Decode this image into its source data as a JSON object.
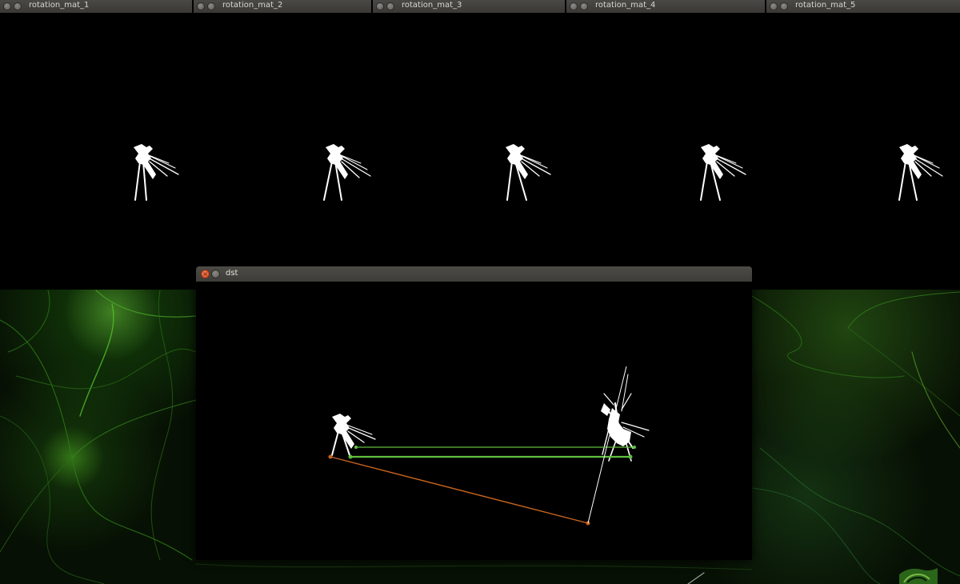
{
  "windows": [
    {
      "title": "rotation_mat_1"
    },
    {
      "title": "rotation_mat_2"
    },
    {
      "title": "rotation_mat_3"
    },
    {
      "title": "rotation_mat_4"
    },
    {
      "title": "rotation_mat_5"
    }
  ],
  "dst_window": {
    "title": "dst"
  },
  "colors": {
    "titlebar": "#3e3d39",
    "close_button": "#e0532b",
    "match_line_green": "#5fbf3f",
    "match_line_orange": "#c8641e",
    "wallpaper_green": "#3fa01f"
  },
  "icons": {
    "close": "close-icon",
    "minimize": "minimize-icon",
    "logo": "nvidia-logo"
  }
}
